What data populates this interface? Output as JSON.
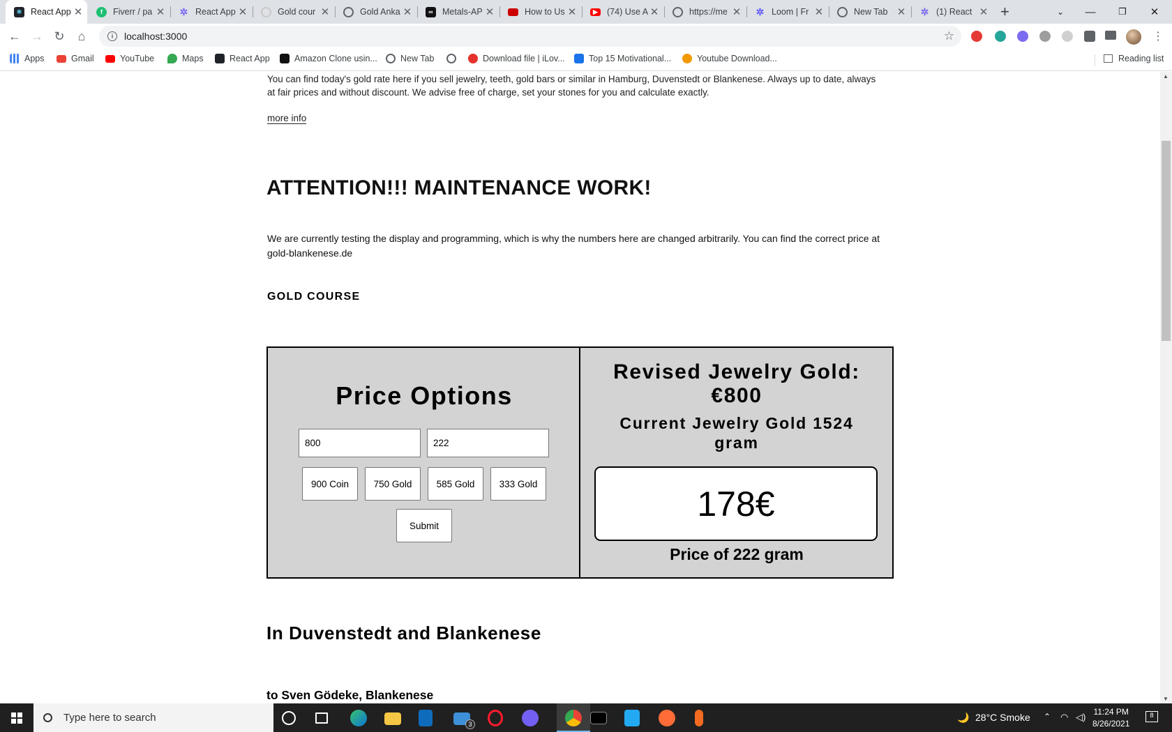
{
  "browser": {
    "tabs": [
      {
        "title": "React App",
        "favicon": "react-icon",
        "color": "#20232a",
        "active": true
      },
      {
        "title": "Fiverr / pa",
        "favicon": "fiverr-icon",
        "color": "#1dbf73"
      },
      {
        "title": "React App",
        "favicon": "react-icon",
        "color": "#7b6cf0"
      },
      {
        "title": "Gold cour",
        "favicon": "loading-icon",
        "color": "#e0e0e0"
      },
      {
        "title": "Gold Anka",
        "favicon": "globe-icon",
        "color": "#5f6368"
      },
      {
        "title": "Metals-AP",
        "favicon": "metals-icon",
        "color": "#111111"
      },
      {
        "title": "How to Us",
        "favicon": "video-icon",
        "color": "#cc0000"
      },
      {
        "title": "(74) Use A",
        "favicon": "youtube-icon",
        "color": "#ff0000"
      },
      {
        "title": "https://me",
        "favicon": "globe-icon",
        "color": "#5f6368"
      },
      {
        "title": "Loom | Fr",
        "favicon": "loom-icon",
        "color": "#625df5"
      },
      {
        "title": "New Tab",
        "favicon": "globe-icon",
        "color": "#5f6368"
      },
      {
        "title": "(1) React",
        "favicon": "react-icon",
        "color": "#7b6cf0"
      }
    ],
    "url": "localhost:3000",
    "bookmarks": [
      {
        "label": "Apps",
        "icon": "apps-grid-icon",
        "color": "#4285f4"
      },
      {
        "label": "Gmail",
        "icon": "gmail-icon",
        "color": "#ea4335"
      },
      {
        "label": "YouTube",
        "icon": "youtube-icon",
        "color": "#ff0000"
      },
      {
        "label": "Maps",
        "icon": "maps-icon",
        "color": "#34a853"
      },
      {
        "label": "React App",
        "icon": "react-icon",
        "color": "#20232a"
      },
      {
        "label": "Amazon Clone usin...",
        "icon": "amazon-icon",
        "color": "#111111"
      },
      {
        "label": "New Tab",
        "icon": "globe-icon",
        "color": "#5f6368"
      },
      {
        "label": "",
        "icon": "globe-icon",
        "color": "#5f6368"
      },
      {
        "label": "Download file | iLov...",
        "icon": "heart-icon",
        "color": "#e5322d"
      },
      {
        "label": "Top 15 Motivational...",
        "icon": "quote-icon",
        "color": "#1a73e8"
      },
      {
        "label": "Youtube Download...",
        "icon": "download-icon",
        "color": "#f29900"
      }
    ],
    "reading_list": "Reading list"
  },
  "page": {
    "intro": "You can find today's gold rate here if you sell jewelry, teeth, gold bars or similar in Hamburg, Duvenstedt or Blankenese. Always up to date, always at fair prices and without discount. We advise free of charge, set your stones for you and calculate exactly.",
    "more_info": "more info",
    "attention": "ATTENTION!!! MAINTENANCE WORK!",
    "testing_notice": "We are currently testing the display and programming, which is why the numbers here are changed arbitrarily. You can find the correct price at gold-blankenese.de",
    "gold_course": "GOLD COURSE",
    "price_options": {
      "title": "Price Options",
      "price_value": "800",
      "gram_value": "222",
      "buttons": [
        "900 Coin",
        "750 Gold",
        "585 Gold",
        "333 Gold"
      ],
      "submit": "Submit"
    },
    "result": {
      "revised_line1": "Revised Jewelry Gold:",
      "revised_line2": "€800",
      "current_line1": "Current Jewelry Gold 1524",
      "current_line2": "gram",
      "price": "178€",
      "price_of": "Price of 222 gram"
    },
    "section_heading": "In Duvenstedt and Blankenese",
    "subheading": "to Sven Gödeke, Blankenese"
  },
  "taskbar": {
    "search_placeholder": "Type here to search",
    "mail_badge": "3",
    "weather": "28°C  Smoke",
    "time": "11:24 PM",
    "date": "8/26/2021",
    "notification_count": "8"
  }
}
